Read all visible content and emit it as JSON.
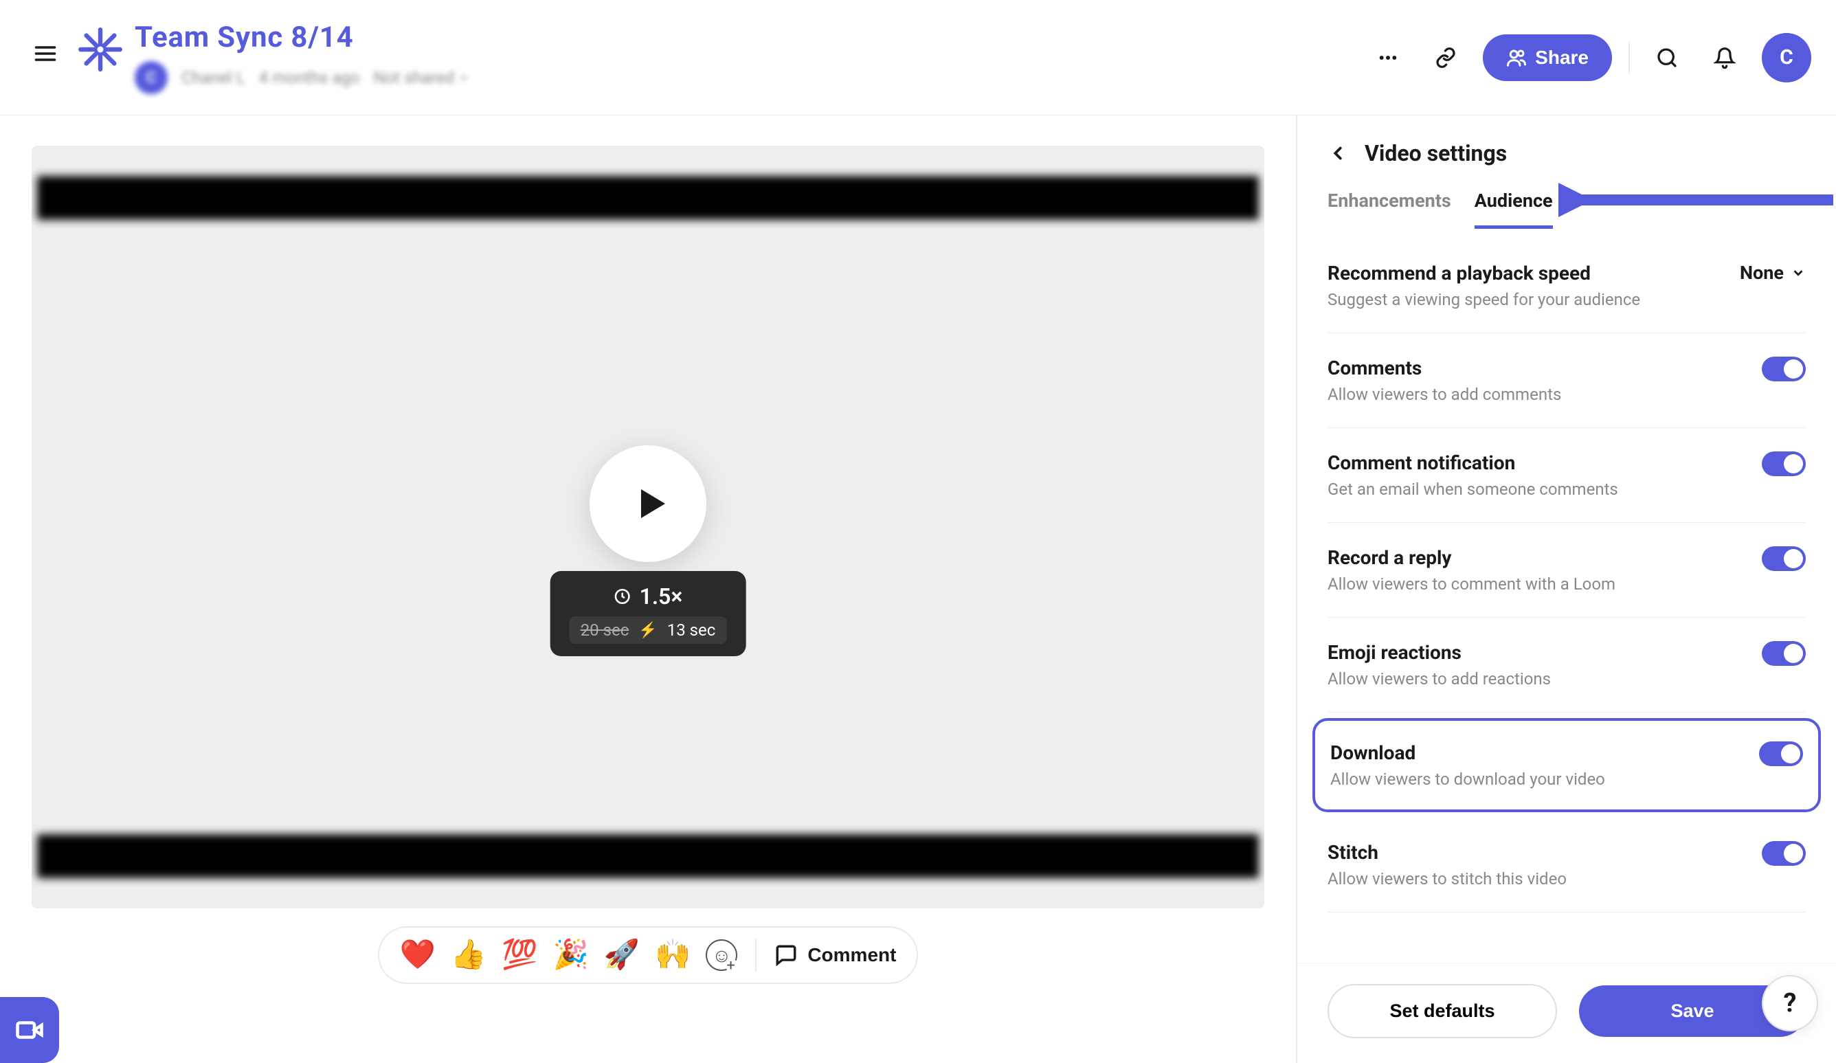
{
  "header": {
    "title": "Team Sync 8/14",
    "avatar_initial": "C",
    "author": "Chanel L",
    "time_ago": "4 months ago",
    "shared_label": "Not shared",
    "share_label": "Share",
    "user_avatar_initial": "C"
  },
  "video": {
    "speed_label": "1.5×",
    "original_duration": "20 sec",
    "new_duration": "13 sec",
    "bolt": "⚡"
  },
  "emoji_bar": {
    "emojis": [
      "❤️",
      "👍",
      "💯",
      "🎉",
      "🚀",
      "🙌"
    ],
    "comment_label": "Comment"
  },
  "sidebar": {
    "title": "Video settings",
    "tabs": {
      "enhancements": "Enhancements",
      "audience": "Audience"
    },
    "settings": {
      "playback": {
        "label": "Recommend a playback speed",
        "desc": "Suggest a viewing speed for your audience",
        "value": "None"
      },
      "comments": {
        "label": "Comments",
        "desc": "Allow viewers to add comments"
      },
      "comment_notif": {
        "label": "Comment notification",
        "desc": "Get an email when someone comments"
      },
      "record_reply": {
        "label": "Record a reply",
        "desc": "Allow viewers to comment with a Loom"
      },
      "emoji_reactions": {
        "label": "Emoji reactions",
        "desc": "Allow viewers to add reactions"
      },
      "download": {
        "label": "Download",
        "desc": "Allow viewers to download your video"
      },
      "stitch": {
        "label": "Stitch",
        "desc": "Allow viewers to stitch this video"
      }
    },
    "footer": {
      "defaults": "Set defaults",
      "save": "Save"
    }
  },
  "help": {
    "label": "?"
  }
}
